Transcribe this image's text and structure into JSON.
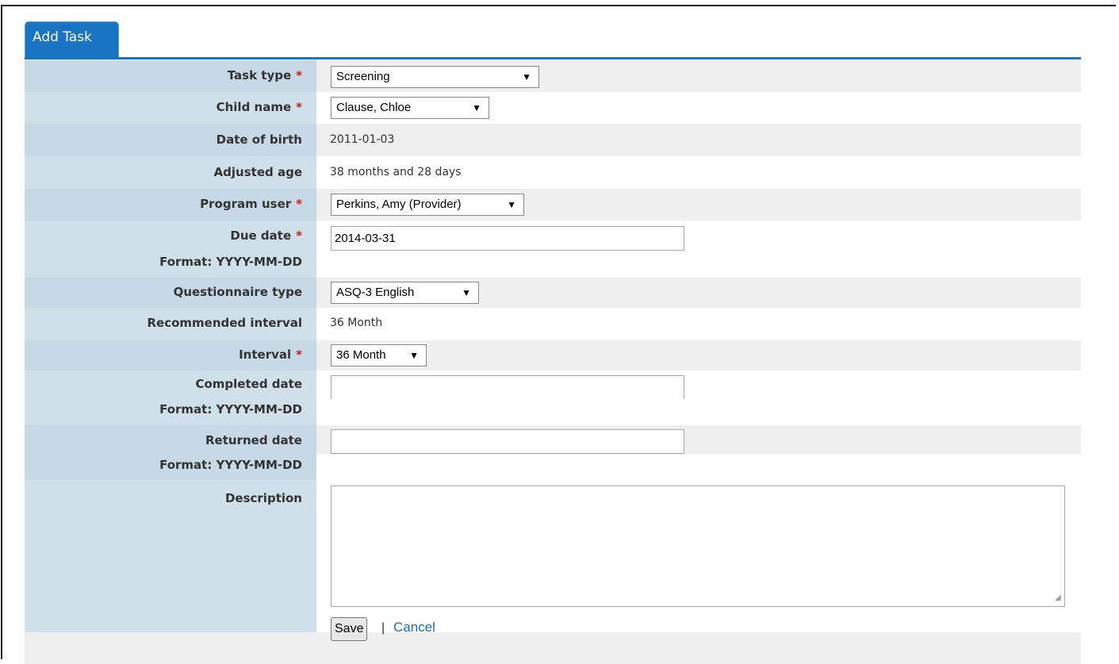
{
  "tab": {
    "label": "Add Task"
  },
  "fields": {
    "task_type": {
      "label": "Task type",
      "value": "Screening"
    },
    "child_name": {
      "label": "Child name",
      "value": "Clause, Chloe"
    },
    "date_of_birth": {
      "label": "Date of birth",
      "value": "2011-01-03"
    },
    "adjusted_age": {
      "label": "Adjusted age",
      "value": "38 months and 28 days"
    },
    "program_user": {
      "label": "Program user",
      "value": "Perkins, Amy (Provider)"
    },
    "due_date": {
      "label": "Due date",
      "format": "Format: YYYY-MM-DD",
      "value": "2014-03-31"
    },
    "questionnaire_type": {
      "label": "Questionnaire type",
      "value": "ASQ-3 English"
    },
    "recommended_interval": {
      "label": "Recommended interval",
      "value": "36 Month"
    },
    "interval": {
      "label": "Interval",
      "value": "36 Month"
    },
    "completed_date": {
      "label": "Completed date",
      "format": "Format: YYYY-MM-DD",
      "value": ""
    },
    "returned_date": {
      "label": "Returned date",
      "format": "Format: YYYY-MM-DD",
      "value": ""
    },
    "description": {
      "label": "Description",
      "value": ""
    }
  },
  "required_marker": "*",
  "actions": {
    "save": "Save",
    "separator": "|",
    "cancel": "Cancel"
  },
  "colors": {
    "accent": "#1a74c4",
    "label_bg": "#cfe0ea",
    "required": "#e0141e",
    "link": "#1b6ea8"
  }
}
